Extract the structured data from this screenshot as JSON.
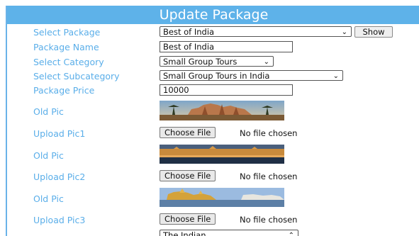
{
  "header": {
    "title": "Update Package"
  },
  "select_package": {
    "label": "Select Package",
    "value": "Best of India",
    "button": "Show"
  },
  "package_name": {
    "label": "Package Name",
    "value": "Best of India"
  },
  "select_category": {
    "label": "Select Category",
    "value": "Small Group Tours"
  },
  "select_subcategory": {
    "label": "Select Subcategory",
    "value": "Small Group Tours in India"
  },
  "package_price": {
    "label": "Package Price",
    "value": "10000"
  },
  "pics": [
    {
      "old_label": "Old Pic",
      "upload_label": "Upload Pic1",
      "choose": "Choose File",
      "status": "No file chosen"
    },
    {
      "old_label": "Old Pic",
      "upload_label": "Upload Pic2",
      "choose": "Choose File",
      "status": "No file chosen"
    },
    {
      "old_label": "Old Pic",
      "upload_label": "Upload Pic3",
      "choose": "Choose File",
      "status": "No file chosen"
    }
  ],
  "bottom_select": {
    "value": "The Indian"
  },
  "colors": {
    "accent": "#5eb2e9",
    "label": "#5aaee9"
  }
}
